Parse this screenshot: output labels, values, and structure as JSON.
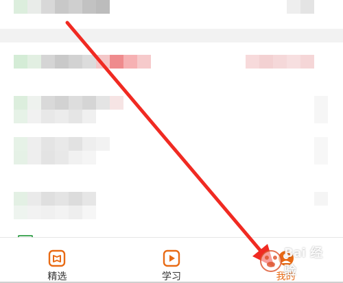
{
  "tab_bar": {
    "tabs": [
      {
        "label": "精选",
        "icon": "book-icon",
        "active": false
      },
      {
        "label": "学习",
        "icon": "play-icon",
        "active": false
      },
      {
        "label": "我的",
        "icon": "profile-icon",
        "active": true
      }
    ]
  },
  "colors": {
    "accent": "#e86a14",
    "arrow": "#f02a22",
    "divider": "#f2f2f2"
  },
  "watermark": {
    "text": "Bai 经验"
  }
}
